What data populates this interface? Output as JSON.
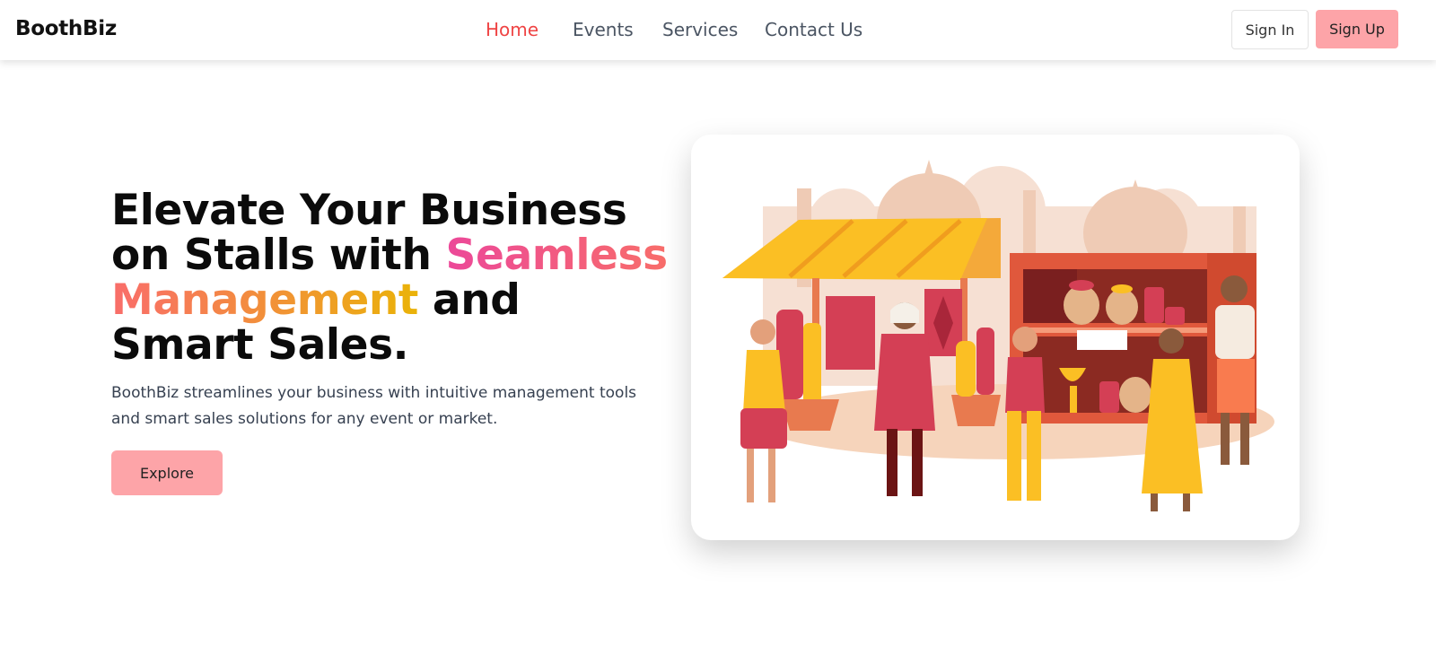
{
  "brand": {
    "name": "BoothBiz"
  },
  "nav": {
    "items": [
      {
        "label": "Home",
        "active": true
      },
      {
        "label": "Events",
        "active": false
      },
      {
        "label": "Services",
        "active": false
      },
      {
        "label": "Contact Us",
        "active": false
      }
    ]
  },
  "auth": {
    "signin_label": "Sign In",
    "signup_label": "Sign Up"
  },
  "hero": {
    "title_part1": "Elevate Your Business on Stalls with ",
    "title_highlight": "Seamless Management",
    "title_part2": " and Smart Sales.",
    "description": "BoothBiz streamlines your business with intuitive management tools and smart sales solutions for any event or market.",
    "cta_label": "Explore"
  },
  "illustration": {
    "icon": "market-stall-illustration"
  },
  "colors": {
    "accent": "#ef4444",
    "button_pink": "#fda4a8",
    "gradient": [
      "#ec4899",
      "#f97066",
      "#eab308"
    ]
  }
}
